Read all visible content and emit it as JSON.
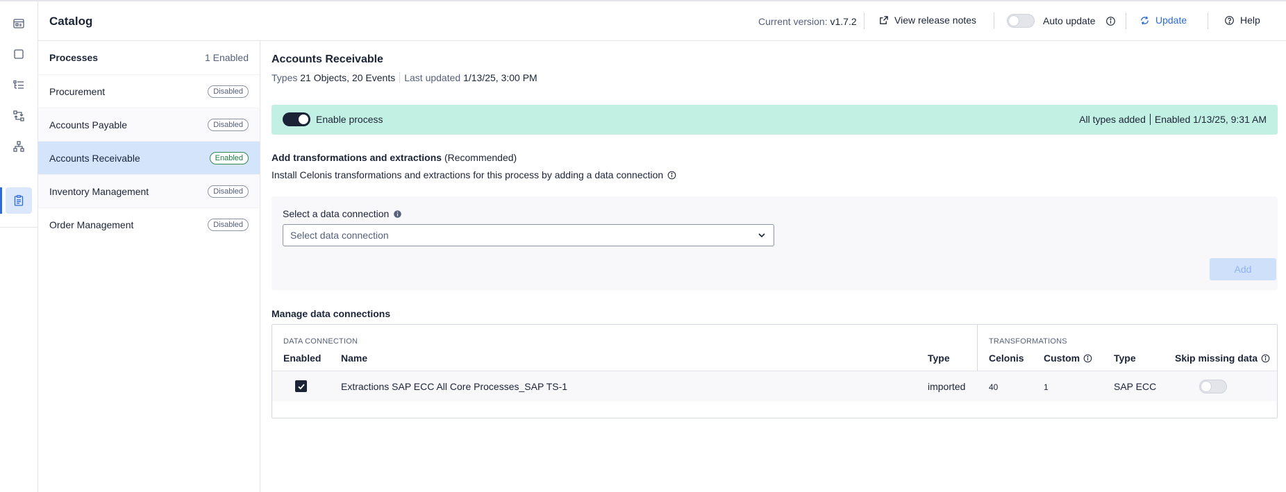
{
  "header": {
    "title": "Catalog",
    "version_label": "Current version: ",
    "version_value": "v1.7.2",
    "release_notes": "View release notes",
    "auto_update": "Auto update",
    "update": "Update",
    "help": "Help"
  },
  "rail": {
    "icons": [
      "dashboard-icon",
      "square-icon",
      "list-tree-icon",
      "transform-icon",
      "hierarchy-icon",
      "clipboard-icon"
    ],
    "active": "clipboard-icon"
  },
  "processes": {
    "heading": "Processes",
    "count": "1 Enabled",
    "items": [
      {
        "label": "Procurement",
        "status": "Disabled"
      },
      {
        "label": "Accounts Payable",
        "status": "Disabled"
      },
      {
        "label": "Accounts Receivable",
        "status": "Enabled"
      },
      {
        "label": "Inventory Management",
        "status": "Disabled"
      },
      {
        "label": "Order Management",
        "status": "Disabled"
      }
    ]
  },
  "main": {
    "title": "Accounts Receivable",
    "types_label": "Types",
    "types_value": "21 Objects, 20 Events",
    "updated_label": "Last updated",
    "updated_value": "1/13/25, 3:00 PM",
    "banner": {
      "label": "Enable process",
      "types_added": "All types added",
      "enabled_label": "Enabled",
      "enabled_value": "1/13/25, 9:31 AM"
    },
    "add_title": "Add transformations and extractions",
    "add_title_suffix": "(Recommended)",
    "add_desc": "Install Celonis transformations and extractions for this process by adding a data connection",
    "select_label": "Select a data connection",
    "select_placeholder": "Select data connection",
    "add_button": "Add",
    "manage_title": "Manage data connections",
    "table": {
      "group_left": "DATA CONNECTION",
      "group_right": "TRANSFORMATIONS",
      "columns": {
        "enabled": "Enabled",
        "name": "Name",
        "type": "Type",
        "celonis": "Celonis",
        "custom": "Custom",
        "ttype": "Type",
        "skip": "Skip missing data"
      },
      "rows": [
        {
          "name": "Extractions SAP ECC All Core Processes_SAP TS-1",
          "type": "imported",
          "celonis": "40",
          "custom": "1",
          "ttype": "SAP ECC"
        }
      ]
    }
  },
  "colors": {
    "accent": "#2c6cd6",
    "banner_bg": "#c2f0e2",
    "selected_row": "#d4e4fb",
    "text": "#1b2437"
  }
}
